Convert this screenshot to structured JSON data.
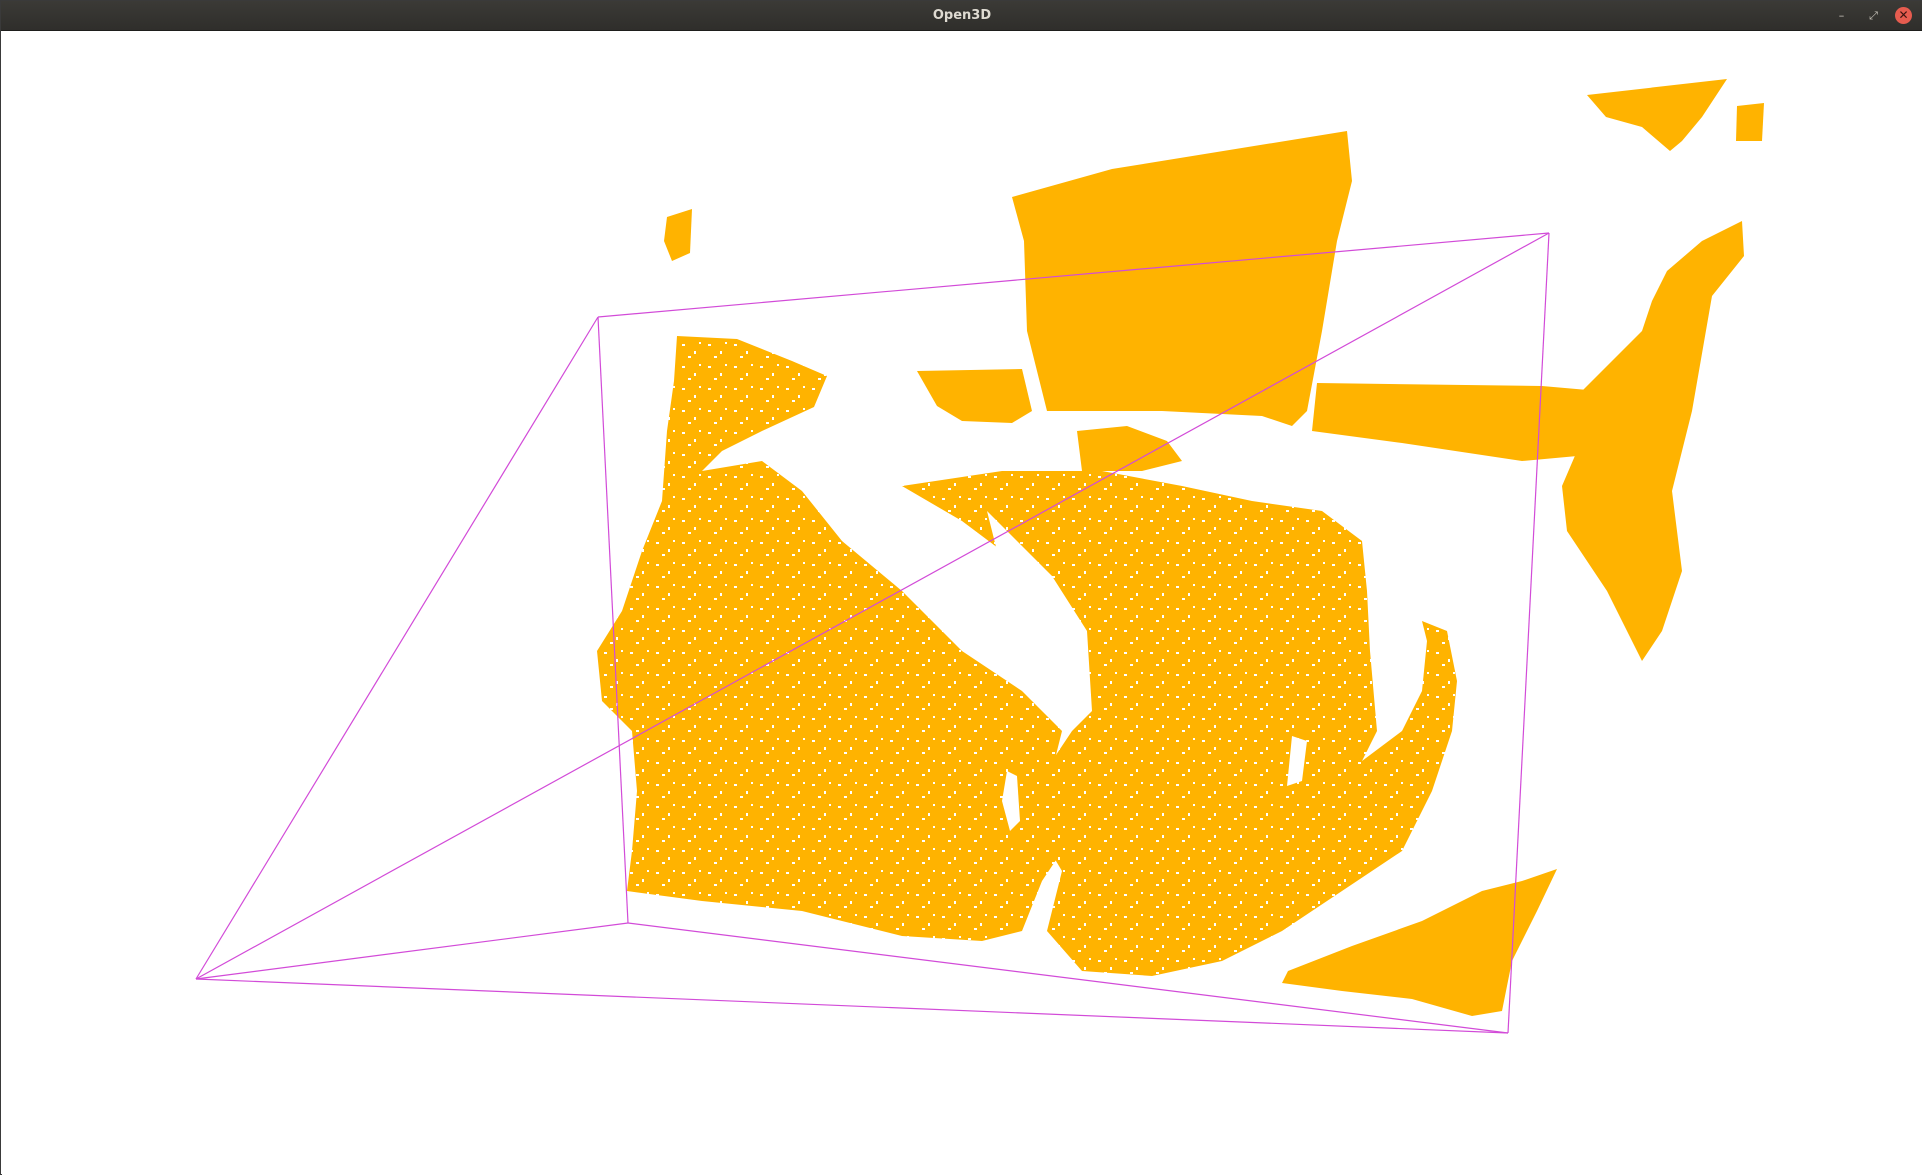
{
  "window": {
    "title": "Open3D",
    "controls": {
      "minimize_icon": "minimize-icon",
      "maximize_icon": "maximize-icon",
      "close_icon": "close-icon",
      "minimize_glyph": "–",
      "maximize_glyph": "⤢",
      "close_glyph": "✕"
    }
  },
  "scene": {
    "background": "#ffffff",
    "point_cloud_color": "#ffb300",
    "frustum_line_color": "#d24bd8"
  }
}
